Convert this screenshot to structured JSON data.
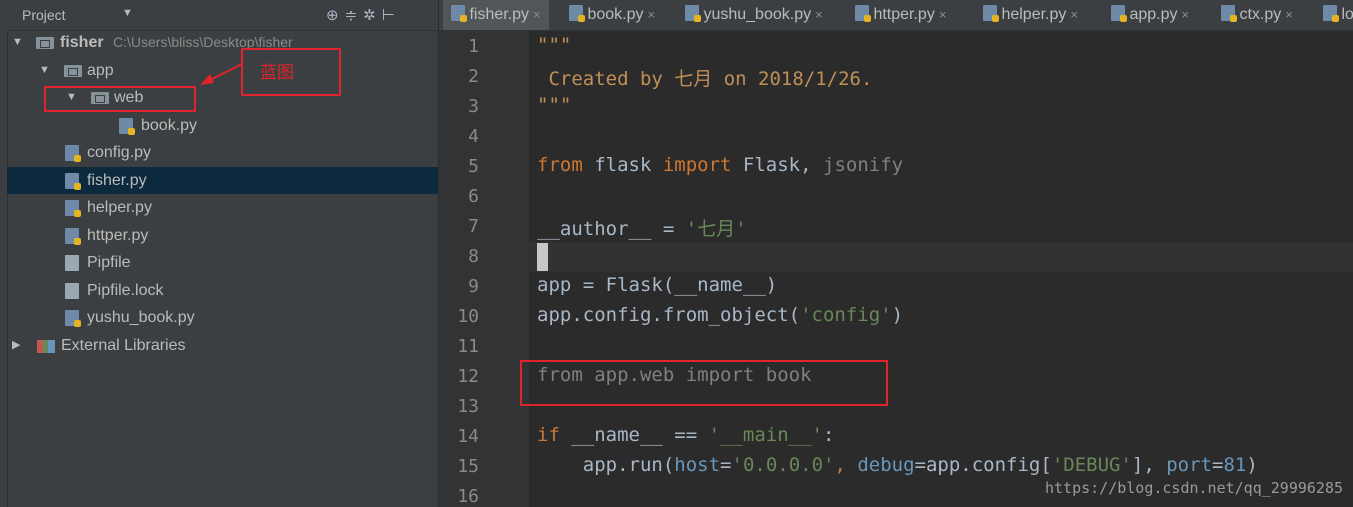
{
  "project_pane": {
    "title": "Project",
    "toolbar_icons": [
      "target-icon",
      "collapse-icon",
      "gear-icon",
      "hide-icon"
    ],
    "tree": [
      {
        "label": "fisher",
        "path": "C:\\Users\\bliss\\Desktop\\fisher",
        "icon": "folder-icon"
      },
      {
        "label": "app",
        "icon": "folder-icon"
      },
      {
        "label": "web",
        "icon": "folder-icon"
      },
      {
        "label": "book.py",
        "icon": "python-file-icon"
      },
      {
        "label": "config.py",
        "icon": "python-file-icon"
      },
      {
        "label": "fisher.py",
        "icon": "python-file-icon",
        "selected": true
      },
      {
        "label": "helper.py",
        "icon": "python-file-icon"
      },
      {
        "label": "httper.py",
        "icon": "python-file-icon"
      },
      {
        "label": "Pipfile",
        "icon": "text-file-icon"
      },
      {
        "label": "Pipfile.lock",
        "icon": "text-file-icon"
      },
      {
        "label": "yushu_book.py",
        "icon": "python-file-icon"
      },
      {
        "label": "External Libraries",
        "icon": "library-icon"
      }
    ]
  },
  "annotation": {
    "label": "蓝图",
    "color": "#e0242b"
  },
  "tabs": [
    {
      "label": "fisher.py",
      "active": true
    },
    {
      "label": "book.py"
    },
    {
      "label": "yushu_book.py"
    },
    {
      "label": "httper.py"
    },
    {
      "label": "helper.py"
    },
    {
      "label": "app.py"
    },
    {
      "label": "ctx.py"
    },
    {
      "label": "lo"
    }
  ],
  "editor": {
    "line_numbers": [
      "1",
      "2",
      "3",
      "4",
      "5",
      "6",
      "7",
      "8",
      "9",
      "10",
      "11",
      "12",
      "13",
      "14",
      "15",
      "16"
    ],
    "code": {
      "l1": "\"\"\"",
      "l2": " Created by 七月 on 2018/1/26.",
      "l3": "\"\"\"",
      "l5_kw1": "from",
      "l5_mod": " flask ",
      "l5_kw2": "import",
      "l5_names": " Flask, ",
      "l5_unused": "jsonify",
      "l7_name": "__author__ = ",
      "l7_str": "'七月'",
      "l9": "app = Flask(__name__)",
      "l10_a": "app.config.from_object(",
      "l10_str": "'config'",
      "l10_b": ")",
      "l12": "from app.web import book",
      "l14_kw": "if",
      "l14_a": " __name__ == ",
      "l14_str": "'__main__'",
      "l14_b": ":",
      "l15_a": "    app.run(",
      "l15_k1": "host",
      "l15_eq1": "=",
      "l15_s1": "'0.0.0.0'",
      "l15_c1": ", ",
      "l15_k2": "debug",
      "l15_eq2": "=app.config[",
      "l15_s2": "'DEBUG'",
      "l15_c2": "], ",
      "l15_k3": "port",
      "l15_eq3": "=",
      "l15_n": "81",
      "l15_end": ")"
    }
  },
  "watermark": "https://blog.csdn.net/qq_29996285",
  "colors": {
    "keyword": "#cc7832",
    "string": "#6a8759",
    "docstring": "#bf8f56",
    "highlight_box": "#e0242b",
    "selection": "#0d293e"
  }
}
